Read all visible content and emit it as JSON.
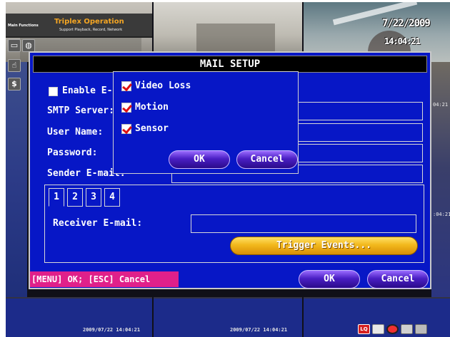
{
  "osd": {
    "date": "7/22/2009",
    "time": "14:04:21",
    "side_time_top": "04:21",
    "side_time_mid": ":04:21",
    "cam_timestamp_1": "2009/07/22 14:04:21",
    "cam_timestamp_2": "2009/07/22 14:04:21"
  },
  "main_functions": {
    "label": "Main Functions",
    "title": "Triplex Operation",
    "subtitle": "Support Playback, Record, Network"
  },
  "dialog": {
    "title": "MAIL SETUP",
    "enable_label": "Enable E-mail Notification",
    "enable_checked": false,
    "fields": {
      "smtp_server": {
        "label": "SMTP Server:",
        "value": ""
      },
      "user_name": {
        "label": "User Name:",
        "value": ""
      },
      "password": {
        "label": "Password:",
        "value": ""
      },
      "sender_email": {
        "label": "Sender E-mail:",
        "value": ""
      }
    },
    "tabs": [
      "1",
      "2",
      "3",
      "4"
    ],
    "active_tab": "1",
    "receiver_label": "Receiver E-mail:",
    "receiver_value": "",
    "trigger_button": "Trigger Events...",
    "ok_button": "OK",
    "cancel_button": "Cancel",
    "hint": "[MENU] OK; [ESC] Cancel"
  },
  "events_popup": {
    "items": [
      {
        "label": "Video Loss",
        "checked": true
      },
      {
        "label": "Motion",
        "checked": true
      },
      {
        "label": "Sensor",
        "checked": true
      }
    ],
    "ok_button": "OK",
    "cancel_button": "Cancel"
  },
  "tray_icons": [
    "lq-icon",
    "monitor-icon",
    "record-icon",
    "shield-icon",
    "settings-icon"
  ],
  "colors": {
    "dialog_blue": "#0717c6",
    "hint_pink": "#e0208a",
    "trigger_orange": "#f2b81c",
    "button_purple": "#4a1fc4",
    "check_red": "#dd1111"
  }
}
